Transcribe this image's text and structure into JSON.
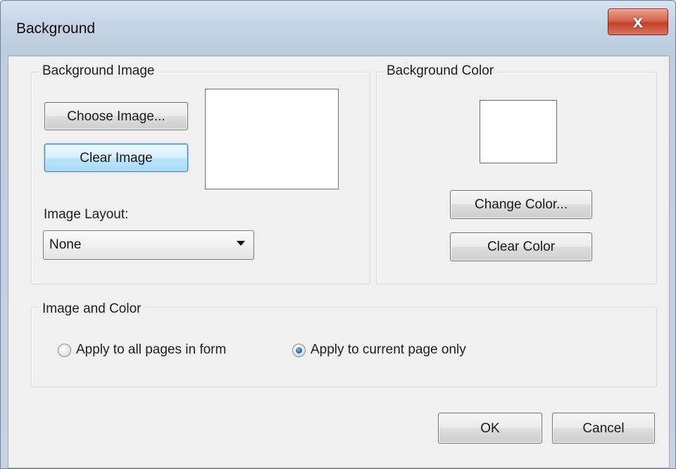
{
  "window": {
    "title": "Background",
    "close_glyph": "x"
  },
  "background_image": {
    "group_title": "Background Image",
    "choose_button": "Choose Image...",
    "clear_button": "Clear Image",
    "layout_label": "Image Layout:",
    "layout_selected": "None"
  },
  "background_color": {
    "group_title": "Background Color",
    "swatch_color": "#ffffff",
    "change_button": "Change Color...",
    "clear_button": "Clear Color"
  },
  "image_and_color": {
    "group_title": "Image and Color",
    "options": [
      {
        "label": "Apply to all pages in form",
        "selected": false
      },
      {
        "label": "Apply to current page only",
        "selected": true
      }
    ]
  },
  "footer": {
    "ok_button": "OK",
    "cancel_button": "Cancel"
  }
}
